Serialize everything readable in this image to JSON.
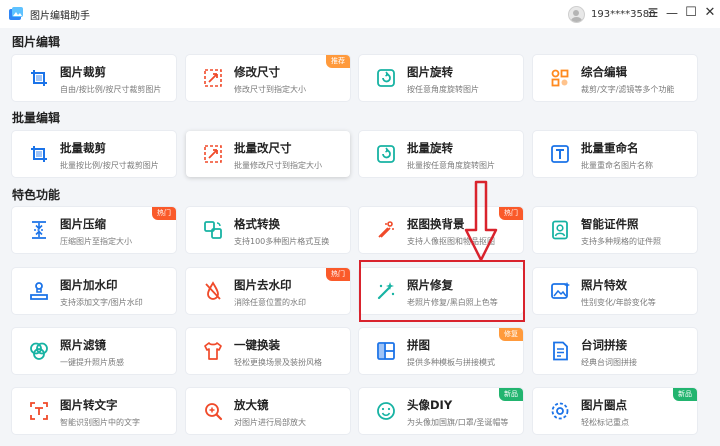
{
  "app": {
    "title": "图片编辑助手",
    "account": "193****3580"
  },
  "colors": {
    "accent": "#1b73e8",
    "hot": "#fa5a2a",
    "recommend": "#ff9a3c",
    "new": "#22b46f",
    "highlight": "#d9232d"
  },
  "sections": [
    {
      "title": "图片编辑",
      "items": [
        {
          "title": "图片裁剪",
          "desc": "自由/按比例/按尺寸裁剪图片",
          "icon": "crop-icon"
        },
        {
          "title": "修改尺寸",
          "desc": "修改尺寸到指定大小",
          "icon": "resize-icon",
          "badge": "推荐",
          "badge_kind": "recommend"
        },
        {
          "title": "图片旋转",
          "desc": "按任意角度旋转图片",
          "icon": "rotate-icon"
        },
        {
          "title": "综合编辑",
          "desc": "裁剪/文字/滤镜等多个功能",
          "icon": "edit-combo-icon"
        }
      ]
    },
    {
      "title": "批量编辑",
      "items": [
        {
          "title": "批量裁剪",
          "desc": "批量按比例/按尺寸裁剪图片",
          "icon": "crop-icon"
        },
        {
          "title": "批量改尺寸",
          "desc": "批量修改尺寸到指定大小",
          "icon": "resize-icon",
          "raised": true
        },
        {
          "title": "批量旋转",
          "desc": "批量按任意角度旋转图片",
          "icon": "rotate-icon"
        },
        {
          "title": "批量重命名",
          "desc": "批量重命名图片名称",
          "icon": "rename-icon"
        }
      ]
    },
    {
      "title": "特色功能",
      "items": [
        {
          "title": "图片压缩",
          "desc": "压缩图片至指定大小",
          "icon": "compress-icon",
          "badge": "热门",
          "badge_kind": "hot"
        },
        {
          "title": "格式转换",
          "desc": "支持100多种图片格式互换",
          "icon": "convert-icon"
        },
        {
          "title": "抠图换背景",
          "desc": "支持人像抠图和物品抠图",
          "icon": "cutout-icon",
          "badge": "热门",
          "badge_kind": "hot"
        },
        {
          "title": "智能证件照",
          "desc": "支持多种规格的证件照",
          "icon": "id-photo-icon"
        },
        {
          "title": "图片加水印",
          "desc": "支持添加文字/图片水印",
          "icon": "add-watermark-icon"
        },
        {
          "title": "图片去水印",
          "desc": "消除任意位置的水印",
          "icon": "remove-watermark-icon",
          "badge": "热门",
          "badge_kind": "hot"
        },
        {
          "title": "照片修复",
          "desc": "老照片修复/黑白照上色等",
          "icon": "magic-wand-icon"
        },
        {
          "title": "照片特效",
          "desc": "性别变化/年龄变化等",
          "icon": "effects-icon"
        },
        {
          "title": "照片滤镜",
          "desc": "一键提升照片质感",
          "icon": "filter-icon"
        },
        {
          "title": "一键换装",
          "desc": "轻松更换场景及装扮风格",
          "icon": "outfit-icon"
        },
        {
          "title": "拼图",
          "desc": "提供多种模板与拼接模式",
          "icon": "collage-icon",
          "badge": "修复",
          "badge_kind": "recommend"
        },
        {
          "title": "台词拼接",
          "desc": "经典台词图拼接",
          "icon": "subtitle-icon"
        },
        {
          "title": "图片转文字",
          "desc": "智能识别图片中的文字",
          "icon": "ocr-icon"
        },
        {
          "title": "放大镜",
          "desc": "对图片进行局部放大",
          "icon": "magnifier-icon"
        },
        {
          "title": "头像DIY",
          "desc": "为头像加国旗/口罩/圣诞帽等",
          "icon": "avatar-diy-icon",
          "badge": "新品",
          "badge_kind": "new"
        },
        {
          "title": "图片圈点",
          "desc": "轻松标记重点",
          "icon": "annotate-icon",
          "badge": "新品",
          "badge_kind": "new"
        }
      ]
    }
  ]
}
